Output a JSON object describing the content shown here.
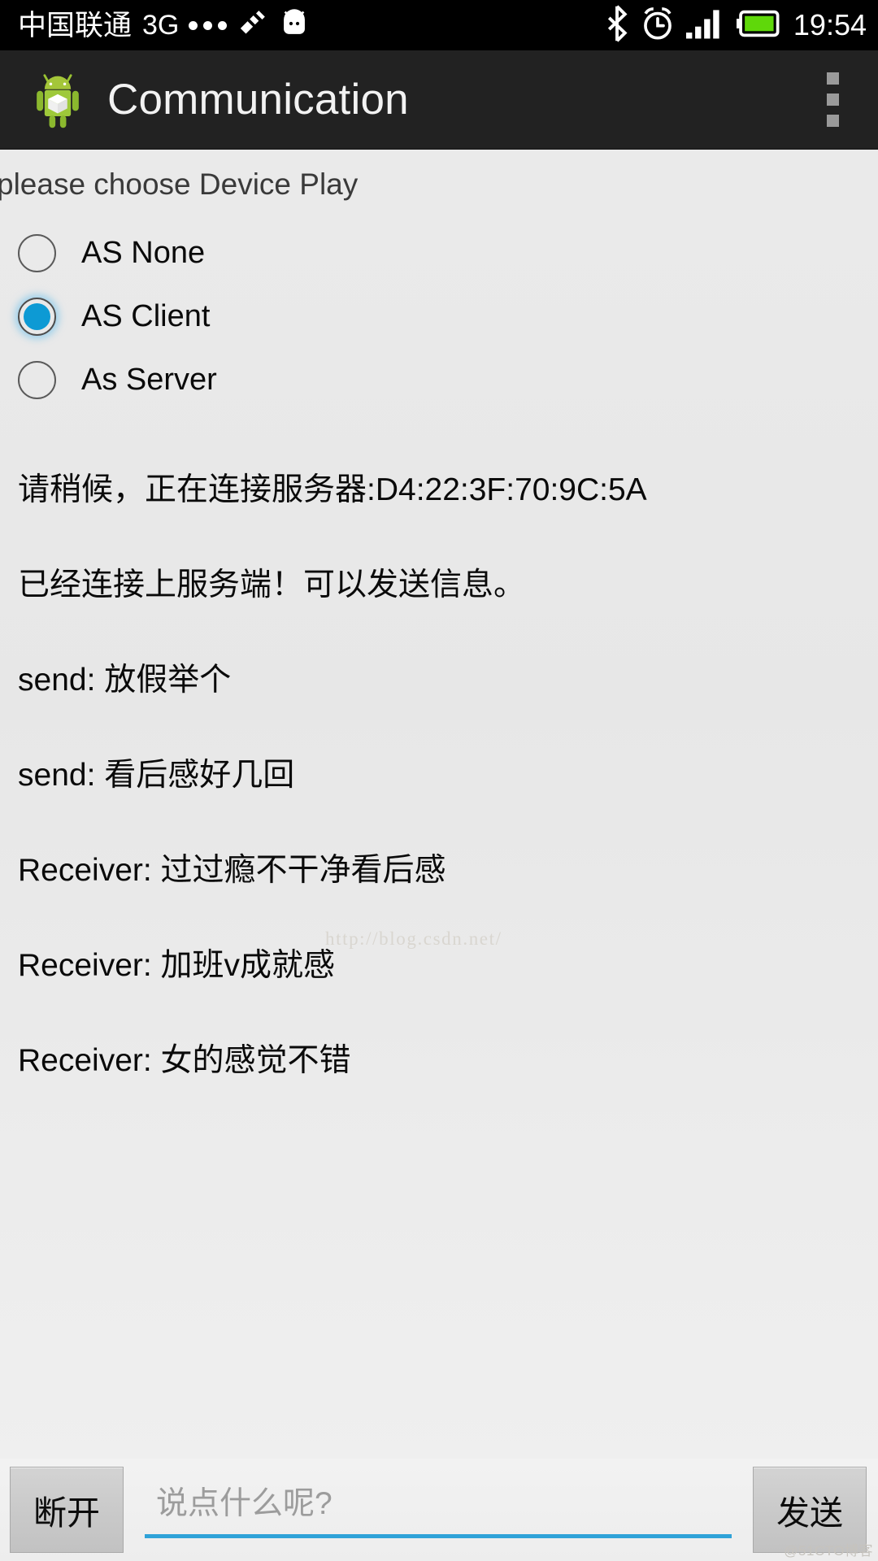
{
  "statusbar": {
    "carrier": "中国联通",
    "network": "3G",
    "dots_count": 3,
    "icons": [
      "vibrate-off-icon",
      "android-head-icon",
      "bluetooth-icon",
      "alarm-clock-icon",
      "signal-bars-icon",
      "battery-icon"
    ],
    "battery_color": "#5fd80a",
    "time": "19:54"
  },
  "actionbar": {
    "app_icon": "android-robot-icon",
    "title": "Communication",
    "overflow": "overflow-menu-icon"
  },
  "main": {
    "hint": "please choose Device Play",
    "radios": [
      {
        "label": "AS None",
        "checked": false
      },
      {
        "label": "AS Client",
        "checked": true
      },
      {
        "label": "As Server",
        "checked": false
      }
    ],
    "accent_color": "#0d9ad4",
    "log_lines": [
      "请稍候，正在连接服务器:D4:22:3F:70:9C:5A",
      "已经连接上服务端！可以发送信息。",
      "send: 放假举个",
      "send: 看后感好几回",
      "Receiver: 过过瘾不干净看后感",
      "Receiver: 加班v成就感",
      "Receiver: 女的感觉不错"
    ],
    "watermark": "http://blog.csdn.net/"
  },
  "bottombar": {
    "disconnect_label": "断开",
    "input_value": "",
    "input_placeholder": "说点什么呢?",
    "underline_color": "#2fa2d8",
    "send_label": "发送",
    "corner_mark": "@51CTO博客"
  }
}
